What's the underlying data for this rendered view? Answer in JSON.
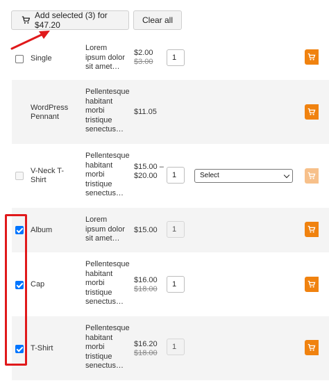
{
  "toolbar": {
    "add_selected_label": "Add selected (3) for $47.20",
    "clear_all_label": "Clear all"
  },
  "products": [
    {
      "checkbox": "unchecked",
      "name": "Single",
      "description": "Lorem ipsum dolor sit amet…",
      "price": "$2.00",
      "old_price": "$3.00",
      "quantity": "1",
      "quantity_editable": true,
      "has_select": false
    },
    {
      "checkbox": "none",
      "name": "WordPress Pennant",
      "description": "Pellentesque habitant morbi tristique senectus…",
      "price": "$11.05",
      "old_price": "",
      "quantity": "",
      "has_select": false
    },
    {
      "checkbox": "disabled",
      "name": "V-Neck T-Shirt",
      "description": "Pellentesque habitant morbi tristique senectus…",
      "price": "$15.00 – $20.00",
      "old_price": "",
      "quantity": "1",
      "quantity_editable": true,
      "has_select": true,
      "select_value": "Select",
      "cart_disabled": true
    },
    {
      "checkbox": "checked",
      "name": "Album",
      "description": "Lorem ipsum dolor sit amet…",
      "price": "$15.00",
      "old_price": "",
      "quantity": "1",
      "quantity_editable": false,
      "has_select": false
    },
    {
      "checkbox": "checked",
      "name": "Cap",
      "description": "Pellentesque habitant morbi tristique senectus…",
      "price": "$16.00",
      "old_price": "$18.00",
      "quantity": "1",
      "quantity_editable": true,
      "has_select": false
    },
    {
      "checkbox": "checked",
      "name": "T-Shirt",
      "description": "Pellentesque habitant morbi tristique senectus…",
      "price": "$16.20",
      "old_price": "$18.00",
      "quantity": "1",
      "quantity_editable": false,
      "has_select": false
    }
  ],
  "colors": {
    "cart_button": "#f0820f",
    "cart_button_disabled": "#f7c08a",
    "checkbox_checked": "#0075ff",
    "annotation_red": "#e0191b"
  },
  "icons": {
    "toolbar_icon": "cart-icon",
    "row_button_icon": "add-to-cart-icon"
  }
}
